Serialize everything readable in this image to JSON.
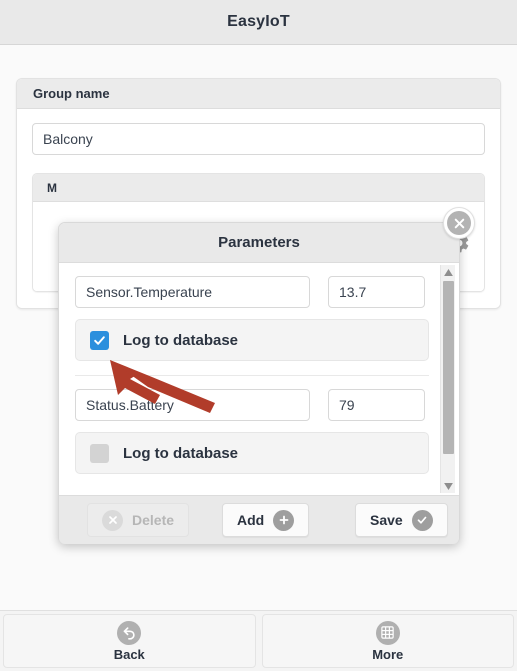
{
  "app": {
    "title": "EasyIoT"
  },
  "group_card": {
    "header": "Group name",
    "name_value": "Balcony",
    "name_placeholder": "Group name",
    "inner_panel": {
      "header": "M",
      "gear_icon": "gear-icon"
    }
  },
  "modal": {
    "title": "Parameters",
    "close_icon": "close-icon",
    "rows": [
      {
        "name": "Sensor.Temperature",
        "value": "13.7",
        "log_label": "Log to database",
        "checked": true
      },
      {
        "name": "Status.Battery",
        "value": "79",
        "log_label": "Log to database",
        "checked": false
      }
    ],
    "footer": {
      "delete_label": "Delete",
      "delete_icon": "circle-x-icon",
      "delete_disabled": true,
      "add_label": "Add",
      "add_icon": "circle-plus-icon",
      "save_label": "Save",
      "save_icon": "circle-check-icon"
    },
    "scrollbar": {
      "up_icon": "caret-up-icon",
      "down_icon": "caret-down-icon"
    }
  },
  "annotation": {
    "arrow_color": "#b13c2a",
    "points_to": "log-to-database-checkbox"
  },
  "bottom_nav": [
    {
      "label": "Back",
      "icon": "back-arrow-icon"
    },
    {
      "label": "More",
      "icon": "grid-icon"
    }
  ]
}
